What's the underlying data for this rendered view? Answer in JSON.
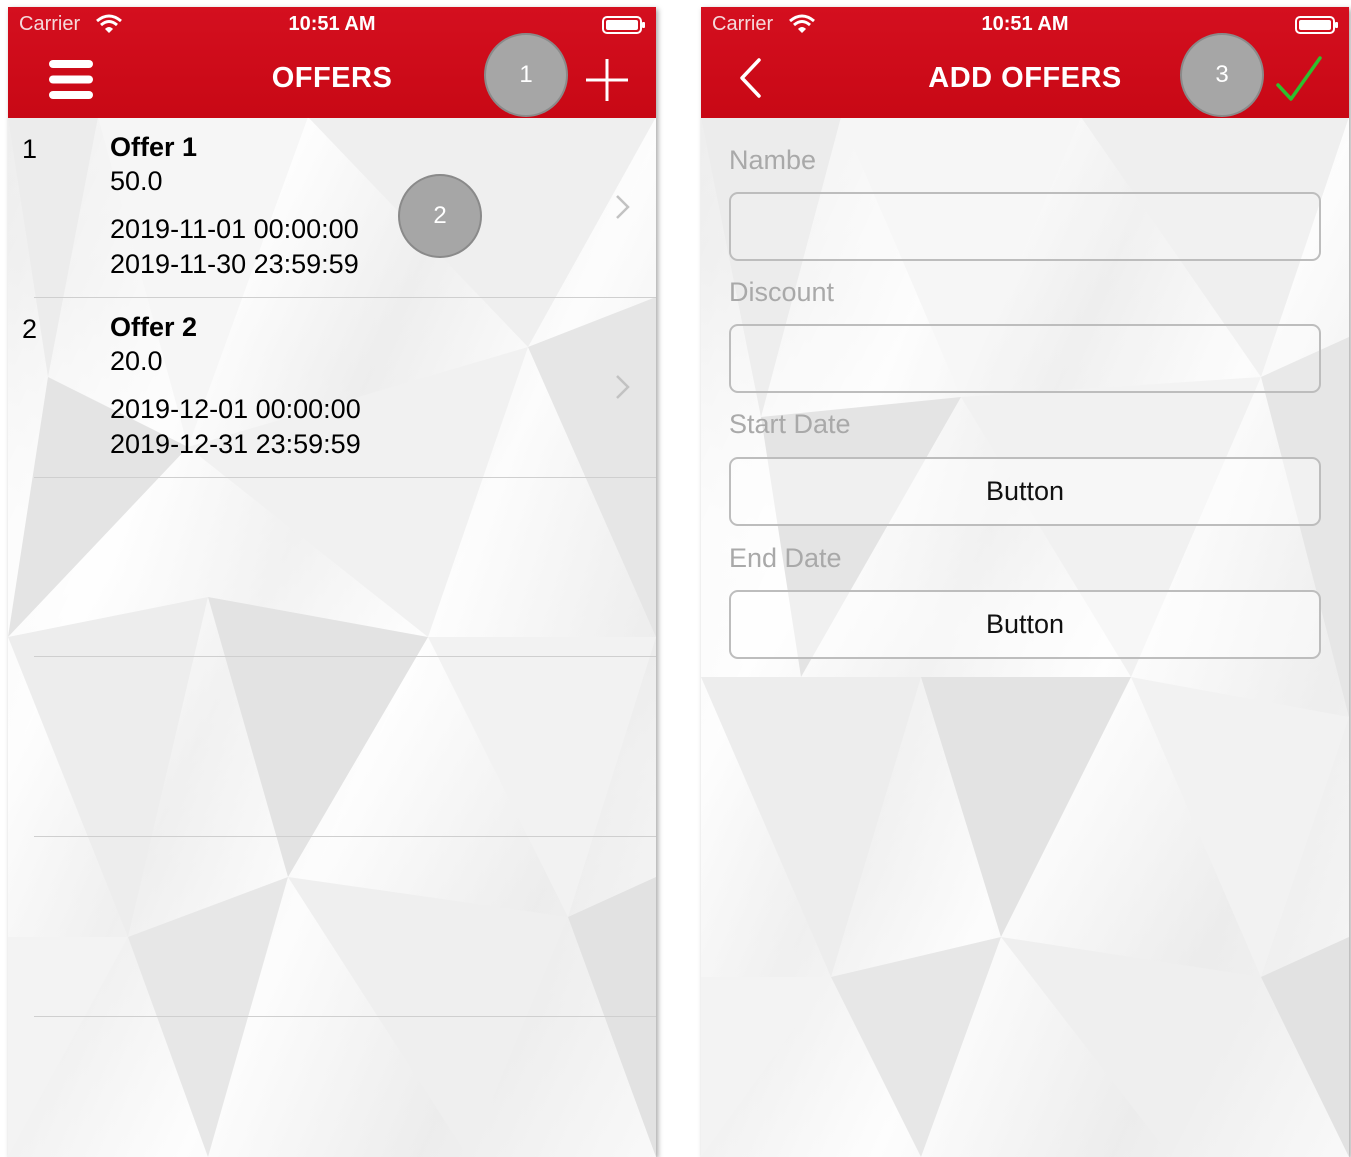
{
  "offers_screen": {
    "status_bar": {
      "carrier": "Carrier",
      "time": "10:51 AM"
    },
    "header": {
      "title": "OFFERS",
      "menu_icon": "hamburger-menu-icon",
      "add_icon": "plus-icon"
    },
    "markers": [
      "1",
      "2"
    ],
    "rows": [
      {
        "index": "1",
        "name": "Offer 1",
        "value": "50.0",
        "start": "2019-11-01 00:00:00",
        "end": "2019-11-30 23:59:59"
      },
      {
        "index": "2",
        "name": "Offer 2",
        "value": "20.0",
        "start": "2019-12-01 00:00:00",
        "end": "2019-12-31 23:59:59"
      }
    ]
  },
  "add_offer_screen": {
    "status_bar": {
      "carrier": "Carrier",
      "time": "10:51 AM"
    },
    "header": {
      "title": "ADD OFFERS",
      "back_icon": "chevron-left-icon",
      "save_icon": "checkmark-icon"
    },
    "marker": "3",
    "fields": {
      "name_label": "Nambe",
      "discount_label": "Discount",
      "start_label": "Start Date",
      "start_button": "Button",
      "end_label": "End Date",
      "end_button": "Button"
    }
  },
  "colors": {
    "header_red": "#d40f1f",
    "marker_gray": "#a6a6a6",
    "check_green": "#2ec02e",
    "label_gray": "#a9a9a9"
  }
}
